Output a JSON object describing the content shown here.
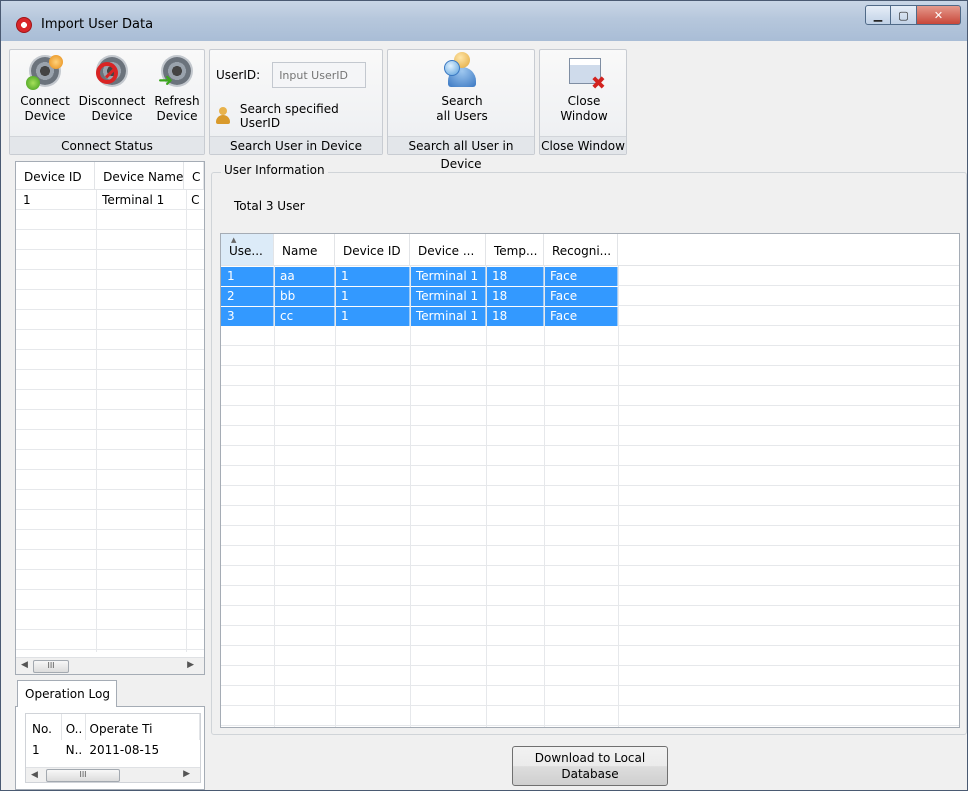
{
  "window": {
    "title": "Import User Data"
  },
  "ribbon": {
    "connect_group": {
      "caption": "Connect Status",
      "connect": "Connect\nDevice",
      "disconnect": "Disconnect\nDevice",
      "refresh": "Refresh\nDevice"
    },
    "search_user_group": {
      "caption": "Search User in Device",
      "userid_label": "UserID:",
      "userid_placeholder": "Input UserID",
      "userid_value": "",
      "search_specified": "Search specified UserID"
    },
    "search_all_group": {
      "caption": "Search all User in Device",
      "search_all": "Search\nall Users"
    },
    "close_group": {
      "caption": "Close Window",
      "close": "Close\nWindow"
    }
  },
  "device_list": {
    "columns": [
      "Device ID",
      "Device Name",
      "C"
    ],
    "rows": [
      [
        "1",
        "Terminal 1",
        "C"
      ]
    ]
  },
  "operation_log": {
    "tab_label": "Operation Log",
    "columns": [
      "No.",
      "O..",
      "Operate Ti"
    ],
    "rows": [
      [
        "1",
        "N..",
        "2011-08-15"
      ]
    ]
  },
  "user_info": {
    "legend": "User Information",
    "total_label": "Total 3 User",
    "columns": [
      "Use...",
      "Name",
      "Device ID",
      "Device ...",
      "Temp...",
      "Recogni..."
    ],
    "rows": [
      [
        "1",
        "aa",
        "1",
        "Terminal 1",
        "18",
        "Face"
      ],
      [
        "2",
        "bb",
        "1",
        "Terminal 1",
        "18",
        "Face"
      ],
      [
        "3",
        "cc",
        "1",
        "Terminal 1",
        "18",
        "Face"
      ]
    ]
  },
  "download_button": "Download to Local\nDatabase",
  "scrollbar_glyph": "III",
  "colors": {
    "selection": "#3399ff",
    "titlebar": "#b6c7dc",
    "close_button": "#c8473a"
  }
}
